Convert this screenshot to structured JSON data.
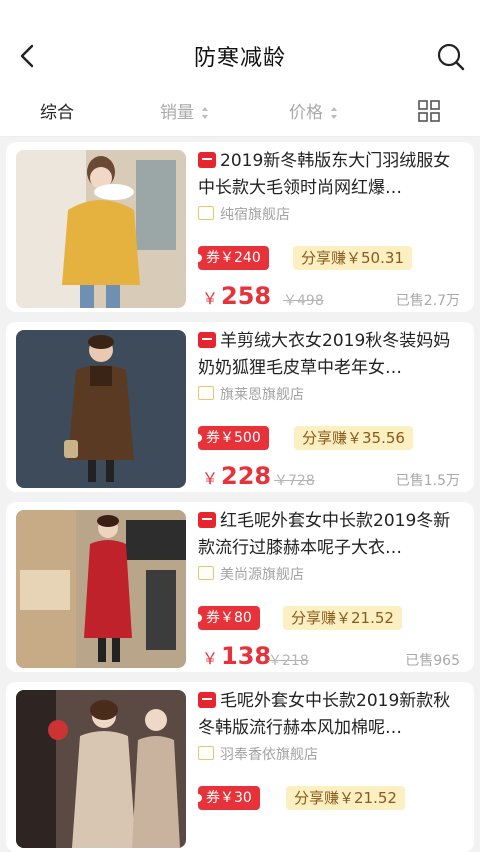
{
  "header": {
    "title": "防寒减龄"
  },
  "sort": {
    "zonghe": "综合",
    "sales": "销量",
    "price": "价格"
  },
  "products": [
    {
      "title": "2019新冬韩版东大门羽绒服女中长款大毛领时尚网红爆…",
      "shop": "纯宿旗舰店",
      "coupon": "券￥240",
      "share": "分享赚￥50.31",
      "price_symbol": "￥",
      "price": "258",
      "orig_price": "￥498",
      "sold": "已售2.7万",
      "coat_color": "#e6b23f",
      "bg_color": "#d8cbb8"
    },
    {
      "title": "羊剪绒大衣女2019秋冬装妈妈奶奶狐狸毛皮草中老年女…",
      "shop": "旗莱恩旗舰店",
      "coupon": "券￥500",
      "share": "分享赚￥35.56",
      "price_symbol": "￥",
      "price": "228",
      "orig_price": "￥728",
      "sold": "已售1.5万",
      "coat_color": "#5a3a22",
      "bg_color": "#3e4b5a"
    },
    {
      "title": "红毛呢外套女中长款2019冬新款流行过膝赫本呢子大衣…",
      "shop": "美尚源旗舰店",
      "coupon": "券￥80",
      "share": "分享赚￥21.52",
      "price_symbol": "￥",
      "price": "138",
      "orig_price": "￥218",
      "sold": "已售965",
      "coat_color": "#c0222b",
      "bg_color": "#b9a58a"
    },
    {
      "title": "毛呢外套女中长款2019新款秋冬韩版流行赫本风加棉呢…",
      "shop": "羽奉香依旗舰店",
      "coupon": "券￥30",
      "share": "分享赚￥21.52",
      "price_symbol": "￥",
      "price": "",
      "orig_price": "",
      "sold": "",
      "coat_color": "#d9c6b2",
      "bg_color": "#5b4a44"
    }
  ]
}
